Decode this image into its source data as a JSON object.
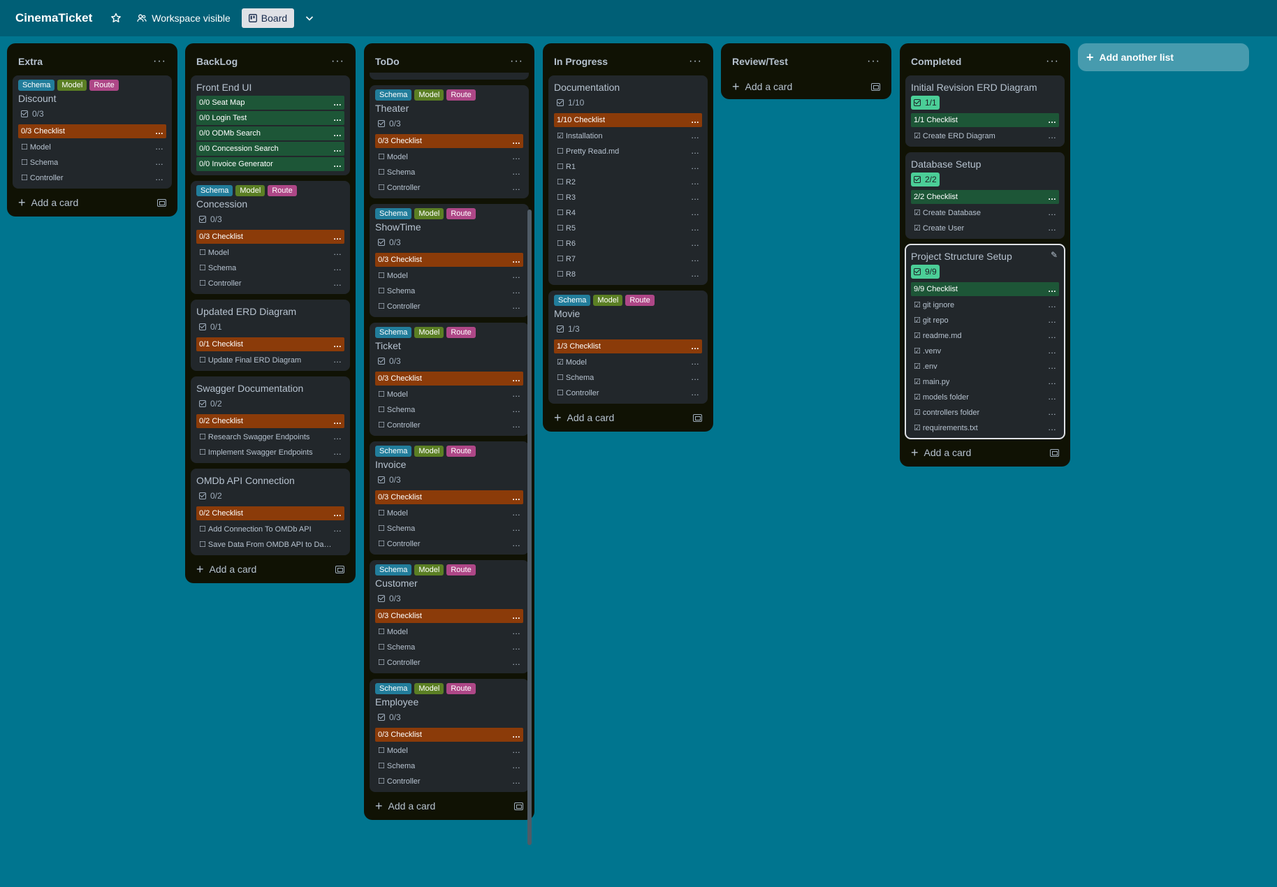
{
  "header": {
    "title": "CinemaTicket",
    "visibility": "Workspace visible",
    "view": "Board"
  },
  "lists": {
    "extra": {
      "title": "Extra",
      "add_card": "Add a card",
      "cards": [
        {
          "labels": [
            "Schema",
            "Model",
            "Route"
          ],
          "title": "Discount",
          "badge": "0/3",
          "checklist": "0/3 Checklist",
          "items": [
            "Model",
            "Schema",
            "Controller"
          ]
        }
      ]
    },
    "backlog": {
      "title": "BackLog",
      "add_card": "Add a card",
      "cards": [
        {
          "title": "Front End UI",
          "checklists": [
            "0/0 Seat Map",
            "0/0 Login Test",
            "0/0 ODMb Search",
            "0/0 Concession Search",
            "0/0 Invoice Generator"
          ]
        },
        {
          "labels": [
            "Schema",
            "Model",
            "Route"
          ],
          "title": "Concession",
          "badge": "0/3",
          "checklist": "0/3 Checklist",
          "items": [
            "Model",
            "Schema",
            "Controller"
          ]
        },
        {
          "title": "Updated ERD Diagram",
          "badge": "0/1",
          "checklist": "0/1 Checklist",
          "items": [
            "Update Final ERD Diagram"
          ]
        },
        {
          "title": "Swagger Documentation",
          "badge": "0/2",
          "checklist": "0/2 Checklist",
          "items": [
            "Research Swagger Endpoints",
            "Implement Swagger Endpoints"
          ]
        },
        {
          "title": "OMDb API Connection",
          "badge": "0/2",
          "checklist": "0/2 Checklist",
          "items": [
            "Add Connection To OMDb API",
            "Save Data From OMDB API to Databas..."
          ]
        }
      ]
    },
    "todo": {
      "title": "ToDo",
      "add_card": "Add a card",
      "cards": [
        {
          "labels": [
            "Schema",
            "Model",
            "Route"
          ],
          "title": "Theater",
          "badge": "0/3",
          "checklist": "0/3 Checklist",
          "items": [
            "Model",
            "Schema",
            "Controller"
          ]
        },
        {
          "labels": [
            "Schema",
            "Model",
            "Route"
          ],
          "title": "ShowTime",
          "badge": "0/3",
          "checklist": "0/3 Checklist",
          "items": [
            "Model",
            "Schema",
            "Controller"
          ]
        },
        {
          "labels": [
            "Schema",
            "Model",
            "Route"
          ],
          "title": "Ticket",
          "badge": "0/3",
          "checklist": "0/3 Checklist",
          "items": [
            "Model",
            "Schema",
            "Controller"
          ]
        },
        {
          "labels": [
            "Schema",
            "Model",
            "Route"
          ],
          "title": "Invoice",
          "badge": "0/3",
          "checklist": "0/3 Checklist",
          "items": [
            "Model",
            "Schema",
            "Controller"
          ]
        },
        {
          "labels": [
            "Schema",
            "Model",
            "Route"
          ],
          "title": "Customer",
          "badge": "0/3",
          "checklist": "0/3 Checklist",
          "items": [
            "Model",
            "Schema",
            "Controller"
          ]
        },
        {
          "labels": [
            "Schema",
            "Model",
            "Route"
          ],
          "title": "Employee",
          "badge": "0/3",
          "checklist": "0/3 Checklist",
          "items": [
            "Model",
            "Schema",
            "Controller"
          ]
        }
      ]
    },
    "inprogress": {
      "title": "In Progress",
      "add_card": "Add a card",
      "cards": [
        {
          "title": "Documentation",
          "badge": "1/10",
          "checklist": "1/10 Checklist",
          "items": [
            "Installation",
            "Pretty Read.md",
            "R1",
            "R2",
            "R3",
            "R4",
            "R5",
            "R6",
            "R7",
            "R8"
          ],
          "checked": [
            true,
            false,
            false,
            false,
            false,
            false,
            false,
            false,
            false,
            false
          ]
        },
        {
          "labels": [
            "Schema",
            "Model",
            "Route"
          ],
          "title": "Movie",
          "badge": "1/3",
          "checklist": "1/3 Checklist",
          "items": [
            "Model",
            "Schema",
            "Controller"
          ],
          "checked": [
            true,
            false,
            false
          ]
        }
      ]
    },
    "review": {
      "title": "Review/Test",
      "add_card": "Add a card"
    },
    "completed": {
      "title": "Completed",
      "add_card": "Add a card",
      "cards": [
        {
          "title": "Initial Revision ERD Diagram",
          "badge": "1/1",
          "checklist": "1/1 Checklist",
          "items": [
            "Create ERD Diagram"
          ]
        },
        {
          "title": "Database Setup",
          "badge": "2/2",
          "checklist": "2/2 Checklist",
          "items": [
            "Create Database",
            "Create User"
          ]
        },
        {
          "title": "Project Structure Setup",
          "badge": "9/9",
          "checklist": "9/9 Checklist",
          "items": [
            "git ignore",
            "git repo",
            "readme.md",
            ".venv",
            ".env",
            "main.py",
            "models folder",
            "controllers folder",
            "requirements.txt"
          ]
        }
      ]
    }
  },
  "add_list": "Add another list",
  "colors": {
    "board_bg": "#00758f",
    "list_bg": "#101204",
    "card_bg": "#22272b",
    "incomplete_checklist": "#8b3b09",
    "complete_checklist": "#1d5637",
    "label_schema": "#227d9b",
    "label_model": "#5b7f24",
    "label_route": "#ae4787",
    "badge_done": "#4bce97"
  }
}
